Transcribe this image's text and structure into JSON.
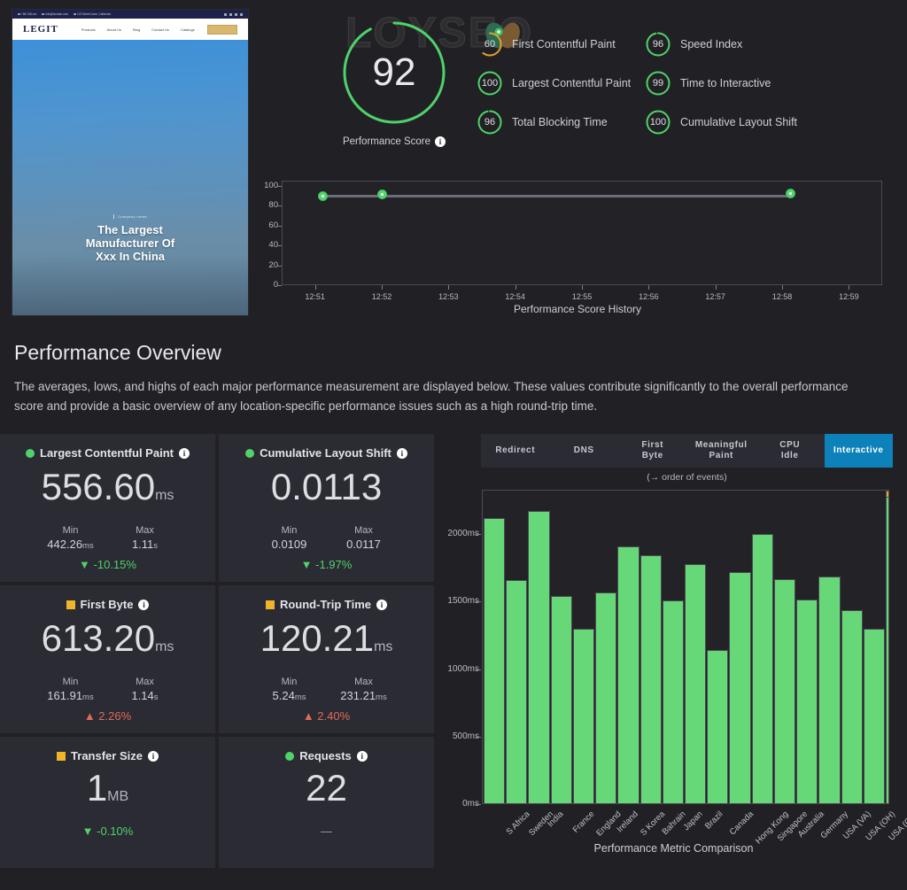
{
  "watermark": "LOYSEO",
  "thumbnail": {
    "topbar_items": [
      "+86 138 xxx",
      "info@domain.com",
      "123 Street Lane, California"
    ],
    "logo": "LEGIT",
    "nav": [
      "Products",
      "About Us",
      "Blog",
      "Contact Us",
      "Catalogs"
    ],
    "hero_eyebrow": "Company name",
    "hero_title": "The Largest Manufacturer Of Xxx In China"
  },
  "score": {
    "value": "92",
    "label": "Performance Score",
    "color": "#4fd26a",
    "percent": 92
  },
  "metrics": [
    {
      "value": "60",
      "label": "First Contentful Paint",
      "color": "#e0a02a",
      "percent": 60
    },
    {
      "value": "100",
      "label": "Largest Contentful Paint",
      "color": "#4fd26a",
      "percent": 100
    },
    {
      "value": "96",
      "label": "Total Blocking Time",
      "color": "#4fd26a",
      "percent": 96
    },
    {
      "value": "96",
      "label": "Speed Index",
      "color": "#4fd26a",
      "percent": 96
    },
    {
      "value": "99",
      "label": "Time to Interactive",
      "color": "#4fd26a",
      "percent": 99
    },
    {
      "value": "100",
      "label": "Cumulative Layout Shift",
      "color": "#4fd26a",
      "percent": 100
    }
  ],
  "overview": {
    "title": "Performance Overview",
    "description": "The averages, lows, and highs of each major performance measurement are displayed below. These values contribute significantly to the overall performance score and provide a basic overview of any location-specific performance issues such as a high round-trip time."
  },
  "cards": [
    {
      "title": "Largest Contentful Paint",
      "status": "green",
      "value": "556.60",
      "unit": "ms",
      "min_label": "Min",
      "min_value": "442.26",
      "min_unit": "ms",
      "max_label": "Max",
      "max_value": "1.11",
      "max_unit": "s",
      "delta": "-10.15%",
      "delta_dir": "down"
    },
    {
      "title": "Cumulative Layout Shift",
      "status": "green",
      "value": "0.0113",
      "unit": "",
      "min_label": "Min",
      "min_value": "0.0109",
      "min_unit": "",
      "max_label": "Max",
      "max_value": "0.0117",
      "max_unit": "",
      "delta": "-1.97%",
      "delta_dir": "down"
    },
    {
      "title": "First Byte",
      "status": "yellow",
      "value": "613.20",
      "unit": "ms",
      "min_label": "Min",
      "min_value": "161.91",
      "min_unit": "ms",
      "max_label": "Max",
      "max_value": "1.14",
      "max_unit": "s",
      "delta": "2.26%",
      "delta_dir": "up"
    },
    {
      "title": "Round-Trip Time",
      "status": "yellow",
      "value": "120.21",
      "unit": "ms",
      "min_label": "Min",
      "min_value": "5.24",
      "min_unit": "ms",
      "max_label": "Max",
      "max_value": "231.21",
      "max_unit": "ms",
      "delta": "2.40%",
      "delta_dir": "up"
    },
    {
      "title": "Transfer Size",
      "status": "yellow",
      "value": "1",
      "unit": "MB",
      "min_label": "",
      "min_value": "",
      "min_unit": "",
      "max_label": "",
      "max_value": "",
      "max_unit": "",
      "delta": "-0.10%",
      "delta_dir": "down"
    },
    {
      "title": "Requests",
      "status": "green",
      "value": "22",
      "unit": "",
      "min_label": "",
      "min_value": "",
      "min_unit": "",
      "max_label": "",
      "max_value": "",
      "max_unit": "",
      "delta": "—",
      "delta_dir": "none"
    }
  ],
  "event_tabs": {
    "items": [
      "Redirect",
      "DNS",
      "First Byte",
      "Meaningful Paint",
      "CPU Idle",
      "Interactive"
    ],
    "active": "Interactive",
    "note": "(→ order of events)",
    "active_color": "#0c81ba"
  },
  "chart_data": [
    {
      "type": "line",
      "title": "Performance Score History",
      "xlabel": "",
      "ylabel": "",
      "x": [
        "12:51",
        "12:52",
        "12:53",
        "12:54",
        "12:55",
        "12:56",
        "12:57",
        "12:58",
        "12:59"
      ],
      "yticks": [
        0,
        20,
        40,
        60,
        80,
        100
      ],
      "ylim": [
        0,
        105
      ],
      "points": [
        {
          "time": "12:51",
          "value": 89
        },
        {
          "time": "12:52",
          "value": 91
        },
        {
          "time": "12:58",
          "value": 92
        }
      ],
      "line_color": "#6a6c78",
      "point_color": "#58d472",
      "grid": false,
      "legend": "none"
    },
    {
      "type": "bar",
      "title": "Performance Metric Comparison",
      "xlabel": "",
      "ylabel": "",
      "categories": [
        "S Africa",
        "Sweden",
        "India",
        "France",
        "England",
        "Ireland",
        "S Korea",
        "Bahrain",
        "Japan",
        "Brazil",
        "Canada",
        "Hong Kong",
        "Singapore",
        "Australia",
        "Germany",
        "USA (VA)",
        "USA (OH)",
        "USA (OR)"
      ],
      "values": [
        2120,
        1660,
        2170,
        1545,
        1300,
        1570,
        1910,
        1845,
        1510,
        1780,
        1145,
        1720,
        2000,
        1665,
        1515,
        1690,
        1440,
        1300
      ],
      "yticks": [
        "0ms",
        "500ms",
        "1000ms",
        "1500ms",
        "2000ms"
      ],
      "ylim": [
        0,
        2330
      ],
      "bar_color": "#67d877",
      "marker_color": "#f0a429",
      "grid": false,
      "legend": "none"
    }
  ]
}
